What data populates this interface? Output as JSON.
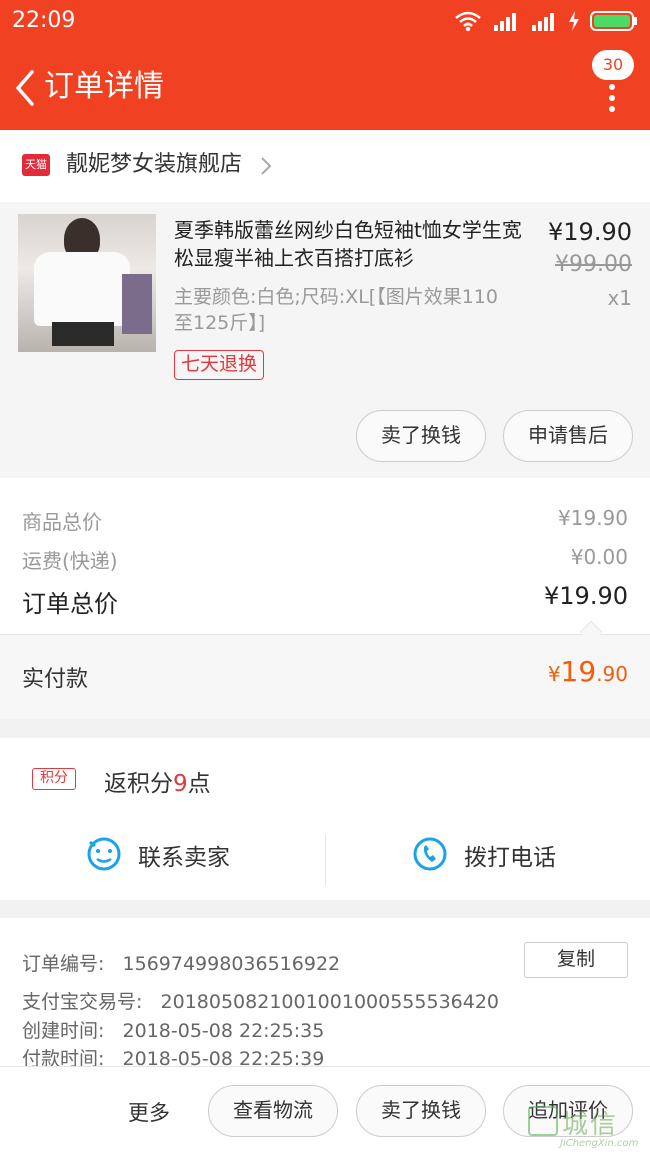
{
  "status_bar": {
    "time": "22:09",
    "battery_color": "#4cd964"
  },
  "header": {
    "title": "订单详情",
    "badge": "30",
    "accent": "#f04223"
  },
  "store": {
    "platform_icon": "天猫",
    "name": "靓妮梦女装旗舰店"
  },
  "product": {
    "title": "夏季韩版蕾丝网纱白色短袖t恤女学生宽松显瘦半袖上衣百搭打底衫",
    "sku": "主要颜色:白色;尺码:XL[【图片效果110至125斤】]",
    "tag": "七天退换",
    "price": "¥19.90",
    "original_price": "¥99.00",
    "quantity": "x1",
    "buttons": [
      "卖了换钱",
      "申请售后"
    ]
  },
  "totals": {
    "goods_label": "商品总价",
    "goods_value": "¥19.90",
    "shipping_label": "运费(快递)",
    "shipping_value": "¥0.00",
    "order_label": "订单总价",
    "order_value": "¥19.90",
    "paid_label": "实付款",
    "paid_currency": "¥",
    "paid_int": "19",
    "paid_dec": ".90"
  },
  "points": {
    "tag": "积分",
    "text_prefix": "返积分",
    "number": "9",
    "text_suffix": "点"
  },
  "contact": {
    "seller": "联系卖家",
    "phone": "拨打电话"
  },
  "order_info": {
    "order_no_label": "订单编号:",
    "order_no": "156974998036516922",
    "copy": "复制",
    "alipay_label": "支付宝交易号:",
    "alipay_no": "2018050821001001000555536420",
    "created_label": "创建时间:",
    "created": "2018-05-08 22:25:35",
    "paid_label": "付款时间:",
    "paid": "2018-05-08 22:25:39"
  },
  "bottom_bar": {
    "more": "更多",
    "buttons": [
      "查看物流",
      "卖了换钱",
      "追加评价"
    ]
  },
  "watermark": {
    "cn": "城信",
    "en": "JiChengXin.com"
  }
}
